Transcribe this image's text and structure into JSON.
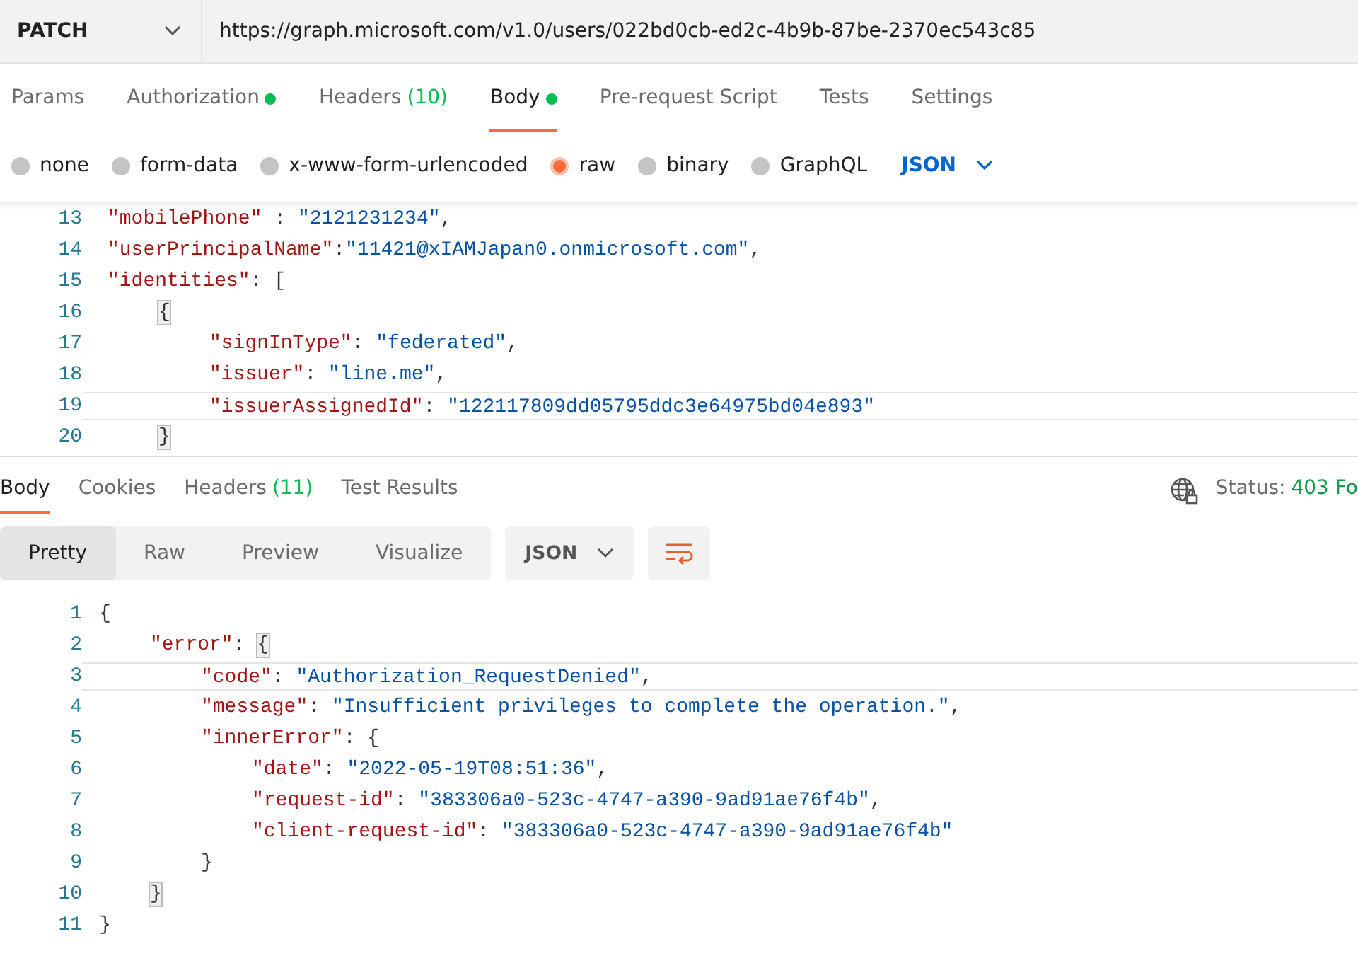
{
  "request": {
    "method": "PATCH",
    "url": "https://graph.microsoft.com/v1.0/users/022bd0cb-ed2c-4b9b-87be-2370ec543c85"
  },
  "request_tabs": [
    {
      "label": "Params",
      "dot": false,
      "selected": false
    },
    {
      "label": "Authorization",
      "dot": true,
      "selected": false
    },
    {
      "label": "Headers",
      "count": "(10)",
      "dot": false,
      "selected": false
    },
    {
      "label": "Body",
      "dot": true,
      "selected": true
    },
    {
      "label": "Pre-request Script",
      "dot": false,
      "selected": false
    },
    {
      "label": "Tests",
      "dot": false,
      "selected": false
    },
    {
      "label": "Settings",
      "dot": false,
      "selected": false
    }
  ],
  "body_types": [
    {
      "label": "none",
      "selected": false
    },
    {
      "label": "form-data",
      "selected": false
    },
    {
      "label": "x-www-form-urlencoded",
      "selected": false
    },
    {
      "label": "raw",
      "selected": true
    },
    {
      "label": "binary",
      "selected": false
    },
    {
      "label": "GraphQL",
      "selected": false
    }
  ],
  "body_format": "JSON",
  "request_body": [
    {
      "number": "13",
      "tokens": [
        {
          "kind": "key",
          "text": "\"mobilePhone\""
        },
        {
          "kind": "punct",
          "text": " : "
        },
        {
          "kind": "string",
          "text": "\"2121231234\""
        },
        {
          "kind": "punct",
          "text": ","
        }
      ]
    },
    {
      "number": "14",
      "tokens": [
        {
          "kind": "key",
          "text": "\"userPrincipalName\""
        },
        {
          "kind": "punct",
          "text": ":"
        },
        {
          "kind": "string",
          "text": "\"11421@xIAMJapan0.onmicrosoft.com\""
        },
        {
          "kind": "punct",
          "text": ","
        }
      ]
    },
    {
      "number": "15",
      "tokens": [
        {
          "kind": "key",
          "text": "\"identities\""
        },
        {
          "kind": "punct",
          "text": ": ["
        }
      ],
      "children": [
        {
          "number": "16",
          "tokens": [
            {
              "kind": "bracket",
              "text": "{"
            }
          ],
          "children": [
            {
              "number": "17",
              "tokens": [
                {
                  "kind": "key",
                  "text": "\"signInType\""
                },
                {
                  "kind": "punct",
                  "text": ": "
                },
                {
                  "kind": "string",
                  "text": "\"federated\""
                },
                {
                  "kind": "punct",
                  "text": ","
                }
              ]
            },
            {
              "number": "18",
              "tokens": [
                {
                  "kind": "key",
                  "text": "\"issuer\""
                },
                {
                  "kind": "punct",
                  "text": ": "
                },
                {
                  "kind": "string",
                  "text": "\"line.me\""
                },
                {
                  "kind": "punct",
                  "text": ","
                }
              ]
            },
            {
              "number": "19",
              "tokens": [
                {
                  "kind": "key",
                  "text": "\"issuerAssignedId\""
                },
                {
                  "kind": "punct",
                  "text": ": "
                },
                {
                  "kind": "string",
                  "text": "\"122117809dd05795ddc3e64975bd04e893\""
                }
              ]
            }
          ]
        },
        {
          "number": "20",
          "tokens": [
            {
              "kind": "bracket",
              "text": "}"
            }
          ]
        }
      ]
    }
  ],
  "response_tabs": [
    {
      "label": "Body",
      "selected": true
    },
    {
      "label": "Cookies",
      "selected": false
    },
    {
      "label": "Headers",
      "count": "(11)",
      "selected": false
    },
    {
      "label": "Test Results",
      "selected": false
    }
  ],
  "status": {
    "label": "Status:",
    "value": "403 Fo"
  },
  "view_modes": [
    {
      "label": "Pretty",
      "selected": true
    },
    {
      "label": "Raw",
      "selected": false
    },
    {
      "label": "Preview",
      "selected": false
    },
    {
      "label": "Visualize",
      "selected": false
    }
  ],
  "response_format": "JSON",
  "response_body": [
    {
      "number": "1",
      "tokens": [
        {
          "kind": "punct",
          "text": "{"
        }
      ],
      "children": [
        {
          "number": "2",
          "tokens": [
            {
              "kind": "key",
              "text": "\"error\""
            },
            {
              "kind": "punct",
              "text": ": "
            },
            {
              "kind": "bracket",
              "text": "{"
            }
          ],
          "children": [
            {
              "number": "3",
              "tokens": [
                {
                  "kind": "key",
                  "text": "\"code\""
                },
                {
                  "kind": "punct",
                  "text": ": "
                },
                {
                  "kind": "string",
                  "text": "\"Authorization_RequestDenied\""
                },
                {
                  "kind": "punct",
                  "text": ","
                }
              ]
            },
            {
              "number": "4",
              "tokens": [
                {
                  "kind": "key",
                  "text": "\"message\""
                },
                {
                  "kind": "punct",
                  "text": ": "
                },
                {
                  "kind": "string",
                  "text": "\"Insufficient privileges to complete the operation.\""
                },
                {
                  "kind": "punct",
                  "text": ","
                }
              ]
            },
            {
              "number": "5",
              "tokens": [
                {
                  "kind": "key",
                  "text": "\"innerError\""
                },
                {
                  "kind": "punct",
                  "text": ": {"
                }
              ],
              "children": [
                {
                  "number": "6",
                  "tokens": [
                    {
                      "kind": "key",
                      "text": "\"date\""
                    },
                    {
                      "kind": "punct",
                      "text": ": "
                    },
                    {
                      "kind": "string",
                      "text": "\"2022-05-19T08:51:36\""
                    },
                    {
                      "kind": "punct",
                      "text": ","
                    }
                  ]
                },
                {
                  "number": "7",
                  "tokens": [
                    {
                      "kind": "key",
                      "text": "\"request-id\""
                    },
                    {
                      "kind": "punct",
                      "text": ": "
                    },
                    {
                      "kind": "string",
                      "text": "\"383306a0-523c-4747-a390-9ad91ae76f4b\""
                    },
                    {
                      "kind": "punct",
                      "text": ","
                    }
                  ]
                },
                {
                  "number": "8",
                  "tokens": [
                    {
                      "kind": "key",
                      "text": "\"client-request-id\""
                    },
                    {
                      "kind": "punct",
                      "text": ": "
                    },
                    {
                      "kind": "string",
                      "text": "\"383306a0-523c-4747-a390-9ad91ae76f4b\""
                    }
                  ]
                }
              ]
            },
            {
              "number": "9",
              "tokens": [
                {
                  "kind": "punct",
                  "text": "}"
                }
              ]
            }
          ]
        },
        {
          "number": "10",
          "tokens": [
            {
              "kind": "bracket",
              "text": "}"
            }
          ]
        }
      ]
    },
    {
      "number": "11",
      "tokens": [
        {
          "kind": "punct",
          "text": "}"
        }
      ]
    }
  ]
}
